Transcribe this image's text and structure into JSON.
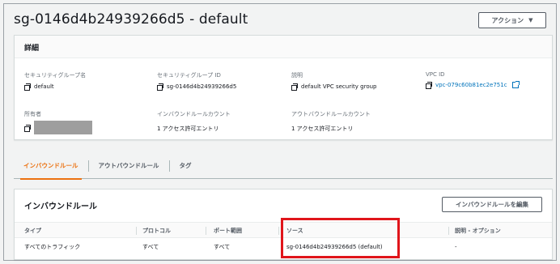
{
  "header": {
    "title": "sg-0146d4b24939266d5 - default",
    "action_label": "アクション",
    "action_caret": "▼"
  },
  "details": {
    "heading": "詳細",
    "fields": [
      {
        "label": "セキュリティグループ名",
        "value": "default"
      },
      {
        "label": "セキュリティグループ ID",
        "value": "sg-0146d4b24939266d5"
      },
      {
        "label": "説明",
        "value": "default VPC security group"
      },
      {
        "label": "VPC ID",
        "value": "vpc-079c60b81ec2e751c"
      },
      {
        "label": "所有者",
        "value": ""
      },
      {
        "label": "インバウンドルールカウント",
        "value": "1 アクセス許可エントリ"
      },
      {
        "label": "アウトバウンドルールカウント",
        "value": "1 アクセス許可エントリ"
      }
    ]
  },
  "tabs": [
    {
      "label": "インバウンドルール",
      "active": true
    },
    {
      "label": "アウトバウンドルール",
      "active": false
    },
    {
      "label": "タグ",
      "active": false
    }
  ],
  "inbound": {
    "title": "インバウンドルール",
    "edit_label": "インバウンドルールを編集",
    "columns": [
      "タイプ",
      "プロトコル",
      "ポート範囲",
      "ソース",
      "説明 - オプション"
    ],
    "rows": [
      [
        "すべてのトラフィック",
        "すべて",
        "すべて",
        "sg-0146d4b24939266d5 (default)",
        "-"
      ]
    ]
  },
  "colors": {
    "accent": "#ec7211",
    "link": "#0073bb",
    "highlight": "#e0151b"
  }
}
